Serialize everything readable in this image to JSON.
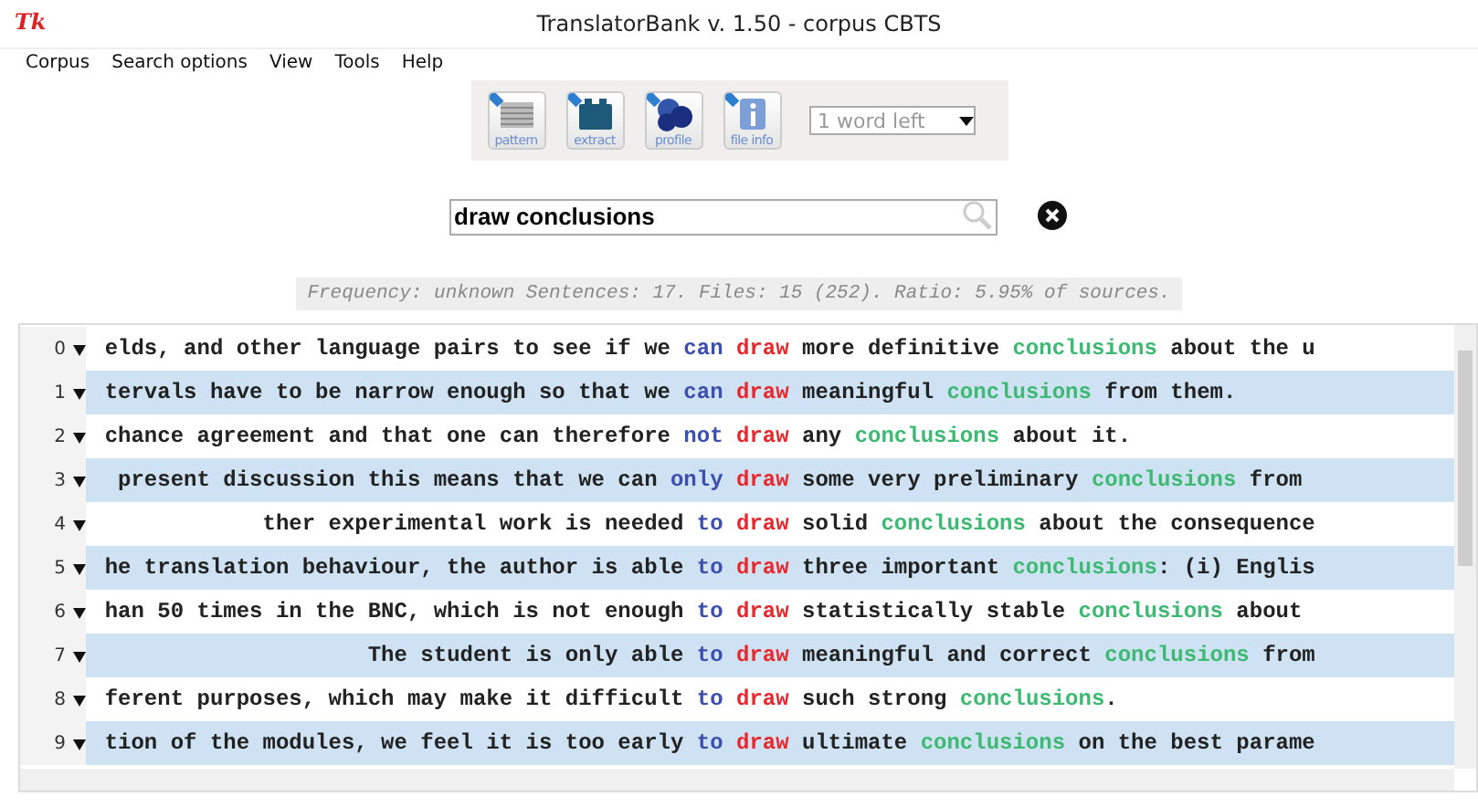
{
  "window": {
    "title": "TranslatorBank v. 1.50 - corpus CBTS",
    "logo": "Tk"
  },
  "menu": [
    "Corpus",
    "Search options",
    "View",
    "Tools",
    "Help"
  ],
  "toolbar": {
    "buttons": [
      {
        "label": "pattern",
        "kind": "pattern"
      },
      {
        "label": "extract",
        "kind": "extract"
      },
      {
        "label": "profile",
        "kind": "profile"
      },
      {
        "label": "file info",
        "kind": "info"
      }
    ],
    "dropdown": "1 word left"
  },
  "search": {
    "value": "draw conclusions"
  },
  "frequency": "Frequency: unknown Sentences: 17. Files: 15 (252). Ratio: 5.95% of sources.",
  "rows": [
    {
      "index": "0",
      "segments": [
        {
          "kind": "plain",
          "text": "elds, and other language pairs to see if we"
        },
        {
          "kind": "pivot",
          "text": "can"
        },
        {
          "kind": "node",
          "text": "draw"
        },
        {
          "kind": "plain",
          "text": "more definitive"
        },
        {
          "kind": "collocate",
          "text": "conclusions"
        },
        {
          "kind": "plain",
          "text": "about the u"
        }
      ]
    },
    {
      "index": "1",
      "segments": [
        {
          "kind": "plain",
          "text": "tervals have to be narrow enough so that we"
        },
        {
          "kind": "pivot",
          "text": "can"
        },
        {
          "kind": "node",
          "text": "draw"
        },
        {
          "kind": "plain",
          "text": "meaningful"
        },
        {
          "kind": "collocate",
          "text": "conclusions"
        },
        {
          "kind": "plain",
          "text": "from them."
        }
      ]
    },
    {
      "index": "2",
      "segments": [
        {
          "kind": "plain",
          "text": "chance agreement and that one can therefore"
        },
        {
          "kind": "pivot",
          "text": "not"
        },
        {
          "kind": "node",
          "text": "draw"
        },
        {
          "kind": "plain",
          "text": "any"
        },
        {
          "kind": "collocate",
          "text": "conclusions"
        },
        {
          "kind": "plain",
          "text": "about it."
        }
      ]
    },
    {
      "index": "3",
      "segments": [
        {
          "kind": "plain",
          "text": "present discussion this means that we can"
        },
        {
          "kind": "pivot",
          "text": "only"
        },
        {
          "kind": "node",
          "text": "draw"
        },
        {
          "kind": "plain",
          "text": "some very preliminary"
        },
        {
          "kind": "collocate",
          "text": "conclusions"
        },
        {
          "kind": "plain",
          "text": "from"
        }
      ]
    },
    {
      "index": "4",
      "segments": [
        {
          "kind": "plain",
          "text": "ther experimental work is needed"
        },
        {
          "kind": "pivot",
          "text": "to"
        },
        {
          "kind": "node",
          "text": "draw"
        },
        {
          "kind": "plain",
          "text": "solid"
        },
        {
          "kind": "collocate",
          "text": "conclusions"
        },
        {
          "kind": "plain",
          "text": "about the consequence"
        }
      ]
    },
    {
      "index": "5",
      "segments": [
        {
          "kind": "plain",
          "text": "he translation behaviour, the author is able"
        },
        {
          "kind": "pivot",
          "text": "to"
        },
        {
          "kind": "node",
          "text": "draw"
        },
        {
          "kind": "plain",
          "text": "three important"
        },
        {
          "kind": "collocate",
          "text": "conclusions"
        },
        {
          "kind": "plain",
          "text": ": (i) Englis"
        }
      ]
    },
    {
      "index": "6",
      "segments": [
        {
          "kind": "plain",
          "text": "han 50 times in the BNC, which is not enough"
        },
        {
          "kind": "pivot",
          "text": "to"
        },
        {
          "kind": "node",
          "text": "draw"
        },
        {
          "kind": "plain",
          "text": "statistically stable"
        },
        {
          "kind": "collocate",
          "text": "conclusions"
        },
        {
          "kind": "plain",
          "text": "about"
        }
      ]
    },
    {
      "index": "7",
      "segments": [
        {
          "kind": "plain",
          "text": "The student is only able"
        },
        {
          "kind": "pivot",
          "text": "to"
        },
        {
          "kind": "node",
          "text": "draw"
        },
        {
          "kind": "plain",
          "text": "meaningful and correct"
        },
        {
          "kind": "collocate",
          "text": "conclusions"
        },
        {
          "kind": "plain",
          "text": "from"
        }
      ]
    },
    {
      "index": "8",
      "segments": [
        {
          "kind": "plain",
          "text": "ferent purposes, which may make it difficult"
        },
        {
          "kind": "pivot",
          "text": "to"
        },
        {
          "kind": "node",
          "text": "draw"
        },
        {
          "kind": "plain",
          "text": "such strong"
        },
        {
          "kind": "collocate",
          "text": "conclusions"
        },
        {
          "kind": "plain",
          "text": "."
        }
      ]
    },
    {
      "index": "9",
      "segments": [
        {
          "kind": "plain",
          "text": "tion of the modules, we feel it is too early"
        },
        {
          "kind": "pivot",
          "text": "to"
        },
        {
          "kind": "node",
          "text": "draw"
        },
        {
          "kind": "plain",
          "text": "ultimate"
        },
        {
          "kind": "collocate",
          "text": "conclusions"
        },
        {
          "kind": "plain",
          "text": "on the best parame"
        }
      ]
    }
  ]
}
